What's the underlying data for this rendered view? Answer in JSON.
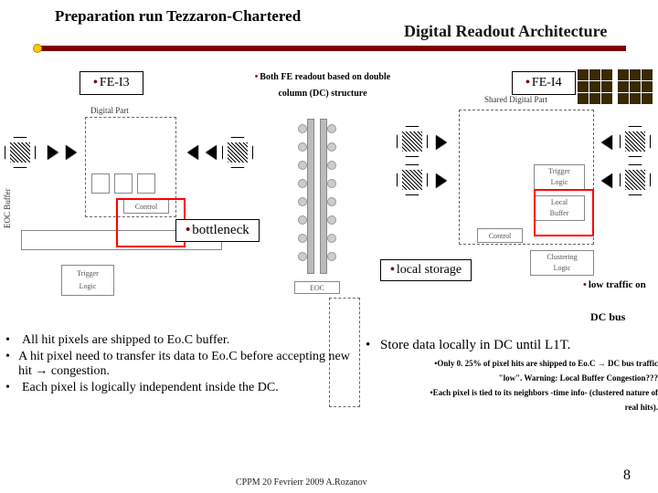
{
  "titles": {
    "left": "Preparation run Tezzaron-Chartered",
    "right": "Digital Readout Architecture"
  },
  "chips": {
    "fei3": "FE-I3",
    "fei4": "FE-I4"
  },
  "center_desc": {
    "line1": "Both FE readout based on double",
    "line2": "column (DC) structure"
  },
  "labels": {
    "bottleneck": "bottleneck",
    "local_storage": "local storage",
    "low_traffic": "low traffic on",
    "dc_bus": "DC bus",
    "digital_part": "Digital Part",
    "shared_digital": "Shared Digital Part",
    "eoc_buffer": "EOC Buffer",
    "control": "Control",
    "trigger_logic": "Trigger\nLogic",
    "local_buffer": "Local\nBuffer",
    "clustering_logic": "Clustering\nLogic",
    "eoc": "EOC"
  },
  "left_bullets": [
    "All hit pixels are shipped to Eo.C buffer.",
    "A hit pixel need to transfer its data to Eo.C before accepting new hit → congestion.",
    "Each pixel is logically independent inside the DC."
  ],
  "right_bullets": {
    "r1": "Store data locally in DC until L1T.",
    "r2": "Only 0. 25% of pixel hits are shipped to Eo.C → DC bus traffic",
    "r3": "\"low\". Warning: Local Buffer Congestion???",
    "r4": "Each pixel is tied to its neighbors -time info- (clustered nature of",
    "r5": "real hits)."
  },
  "footer": "CPPM 20 Fevrierr 2009 A.Rozanov",
  "page": "8"
}
